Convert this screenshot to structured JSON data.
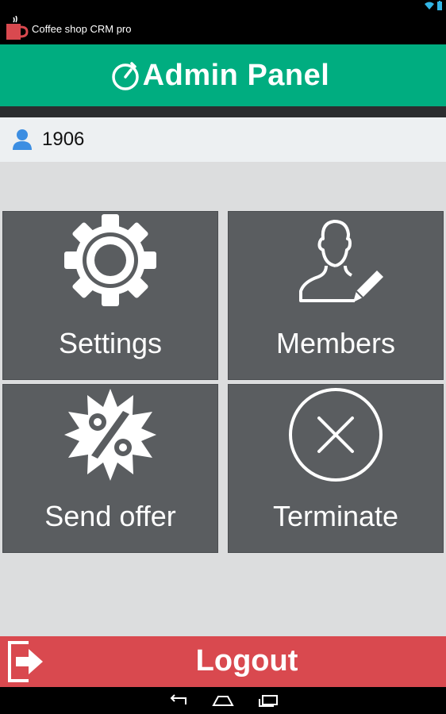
{
  "app": {
    "title": "Coffee shop CRM pro"
  },
  "header": {
    "title": "Admin Panel"
  },
  "user": {
    "id": "1906"
  },
  "tiles": [
    {
      "label": "Settings",
      "icon": "gear-icon"
    },
    {
      "label": "Members",
      "icon": "member-edit-icon"
    },
    {
      "label": "Send offer",
      "icon": "percent-badge-icon"
    },
    {
      "label": "Terminate",
      "icon": "close-circle-icon"
    }
  ],
  "logout": {
    "label": "Logout",
    "icon": "logout-icon"
  },
  "colors": {
    "header_green": "#00ad80",
    "tile_gray": "#5a5d60",
    "logout_red": "#d9494f",
    "user_icon_blue": "#3c8ee2"
  }
}
